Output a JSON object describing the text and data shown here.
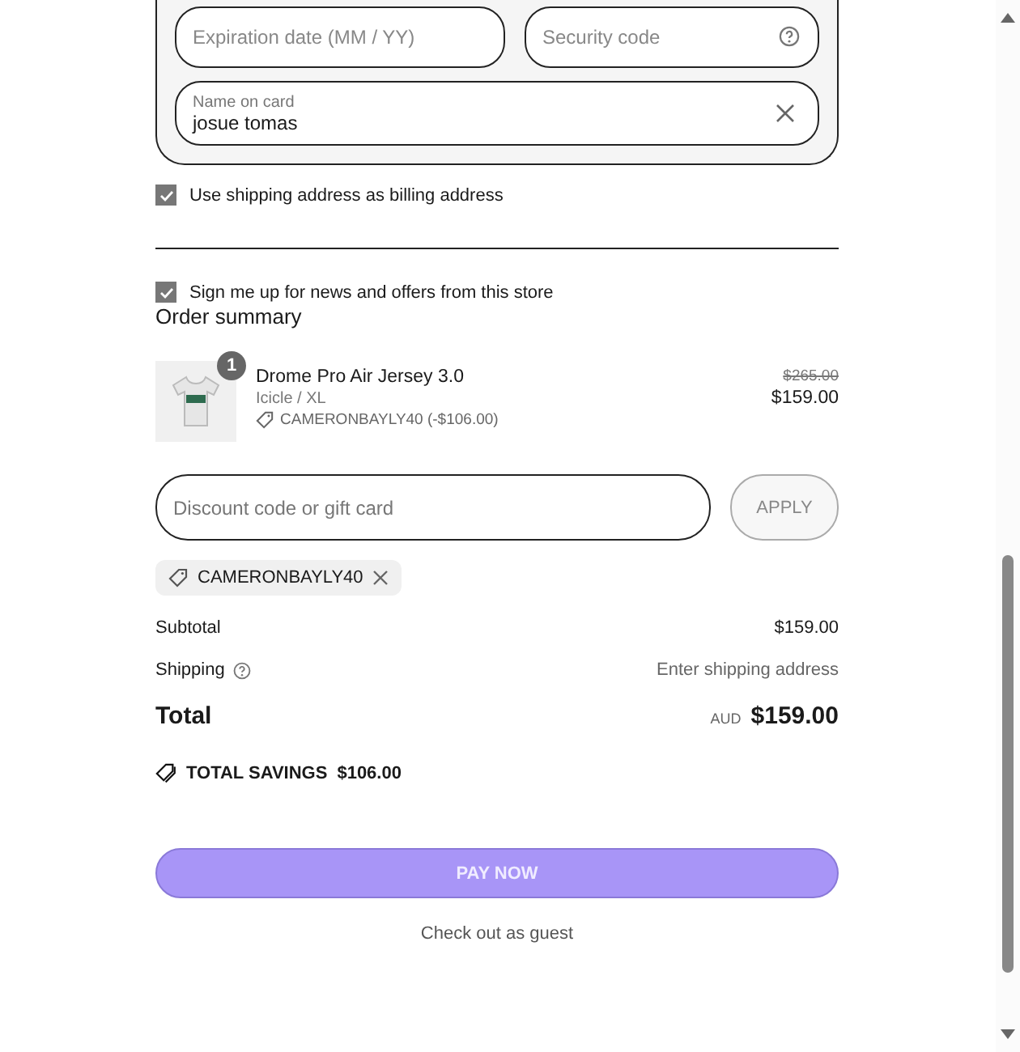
{
  "card_fields": {
    "expiration": {
      "placeholder": "Expiration date (MM / YY)"
    },
    "security": {
      "placeholder": "Security code"
    },
    "name": {
      "label": "Name on card",
      "value": "josue tomas"
    }
  },
  "billing_checkbox": {
    "label": "Use shipping address as billing address",
    "checked": true
  },
  "newsletter_checkbox": {
    "label": "Sign me up for news and offers from this store",
    "checked": true
  },
  "order_summary": {
    "title": "Order summary",
    "items": [
      {
        "quantity": "1",
        "name": "Drome Pro Air Jersey 3.0",
        "variant": "Icicle / XL",
        "discount": "CAMERONBAYLY40 (-$106.00)",
        "original_price": "$265.00",
        "price": "$159.00"
      }
    ],
    "discount_field": {
      "placeholder": "Discount code or gift card"
    },
    "apply_button": "APPLY",
    "applied_codes": [
      "CAMERONBAYLY40"
    ],
    "subtotal": {
      "label": "Subtotal",
      "value": "$159.00"
    },
    "shipping": {
      "label": "Shipping",
      "value": "Enter shipping address"
    },
    "total": {
      "label": "Total",
      "currency": "AUD",
      "value": "$159.00"
    },
    "savings": {
      "label": "TOTAL SAVINGS",
      "value": "$106.00"
    }
  },
  "pay_button": "PAY NOW",
  "guest_link": "Check out as guest"
}
